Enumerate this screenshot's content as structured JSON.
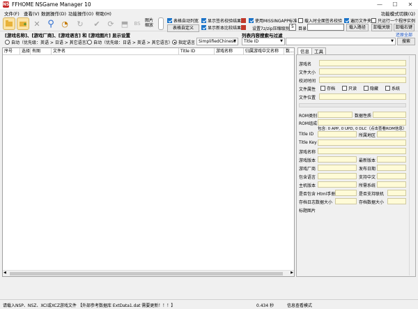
{
  "window": {
    "title": "FFHOME NSGame Manager 10",
    "icon_text": "NS"
  },
  "menu": {
    "items": [
      "文件(F)",
      "查看(V)",
      "数据操作(D)",
      "功能操作(O)",
      "帮助(H)"
    ],
    "right": "功能模式切换(Q)"
  },
  "toolbar": {
    "label_image_scale": "图片\n缩放",
    "checkboxes": [
      {
        "label": "表格自动列宽",
        "checked": true
      },
      {
        "label": "显示签名校验结果",
        "checked": true
      },
      {
        "label": "使用MISSINGAPP标准",
        "checked": true
      },
      {
        "label": "载入时全面签名校验",
        "checked": false
      },
      {
        "label": "遍历文件夹",
        "checked": true
      },
      {
        "label": "只运行一个程序实例",
        "checked": false
      },
      {
        "label": "显示新本比较结果",
        "checked": true
      }
    ],
    "button_table_custom": "表格自定义",
    "setting_label": "设置7z/zip压缩级别",
    "setting_value": "5",
    "dir_label": "目录",
    "button_load_path": "载入路径",
    "button_unload_all": "卸载关联",
    "button_unload_right": "卸载右键",
    "color_red": "#c0392b"
  },
  "options": {
    "header": "[游戏名称]、[游戏厂商]、[游戏语言] 和 [游戏图片] 显示设置",
    "radio_auto": "自动（优先级：英语 > 日语 > 其它语言）",
    "radio_auto2": "自动（优先级：日语 > 英语 > 其它语言）",
    "radio_specify": "指定语言",
    "lang_value": "SimplifiedChinese",
    "search_header": "列表内容搜索与过滤",
    "search_field": "Title ID",
    "search_button": "搜索",
    "reset_link": "还原全部"
  },
  "grid": {
    "columns": [
      "序号",
      "选择",
      "有图",
      "文件名",
      "Title ID",
      "游戏名称",
      "归属游戏中文名称",
      "数..."
    ]
  },
  "rightpanel": {
    "tabs": [
      "信息",
      "工具"
    ],
    "labels": {
      "game_name": "游戏名",
      "file_size": "文件大小",
      "check_time": "校对时间",
      "file_attr": "文件属性",
      "file_pos": "文件位置",
      "rom_type": "ROM类别",
      "data_nature": "数据性质",
      "rom_comp": "ROM组成",
      "rom_detail": "包含: 0 APP, 0 UPD, 0 DLC（点击查看ROM信息）",
      "title_id": "Title ID",
      "region": "所属地区",
      "title_key": "Title Key",
      "game_name2": "游戏名称",
      "game_ver": "游戏版本",
      "latest_ver": "最新版本",
      "publisher": "游戏厂商",
      "release": "发布日期",
      "lang": "包含语言",
      "support_cn": "支持中文",
      "main_ver": "主机版本",
      "req_sys": "所需系统",
      "html_manual": "是否包含 Html手册",
      "online": "是否支持联机",
      "save_size": "存档日志数据大小",
      "save_data": "存档数据大小",
      "cover": "标题图片"
    },
    "attrs": [
      "存档",
      "只读",
      "隐藏",
      "系统"
    ]
  },
  "status": {
    "left": "请载入NSP、NSZ、XCI或XCZ游戏文件",
    "notice": "【外部参考数据库 ExtData1.dat 需要更新！！！】",
    "ver": "0.434 秒",
    "mode": "信息查看模式"
  }
}
